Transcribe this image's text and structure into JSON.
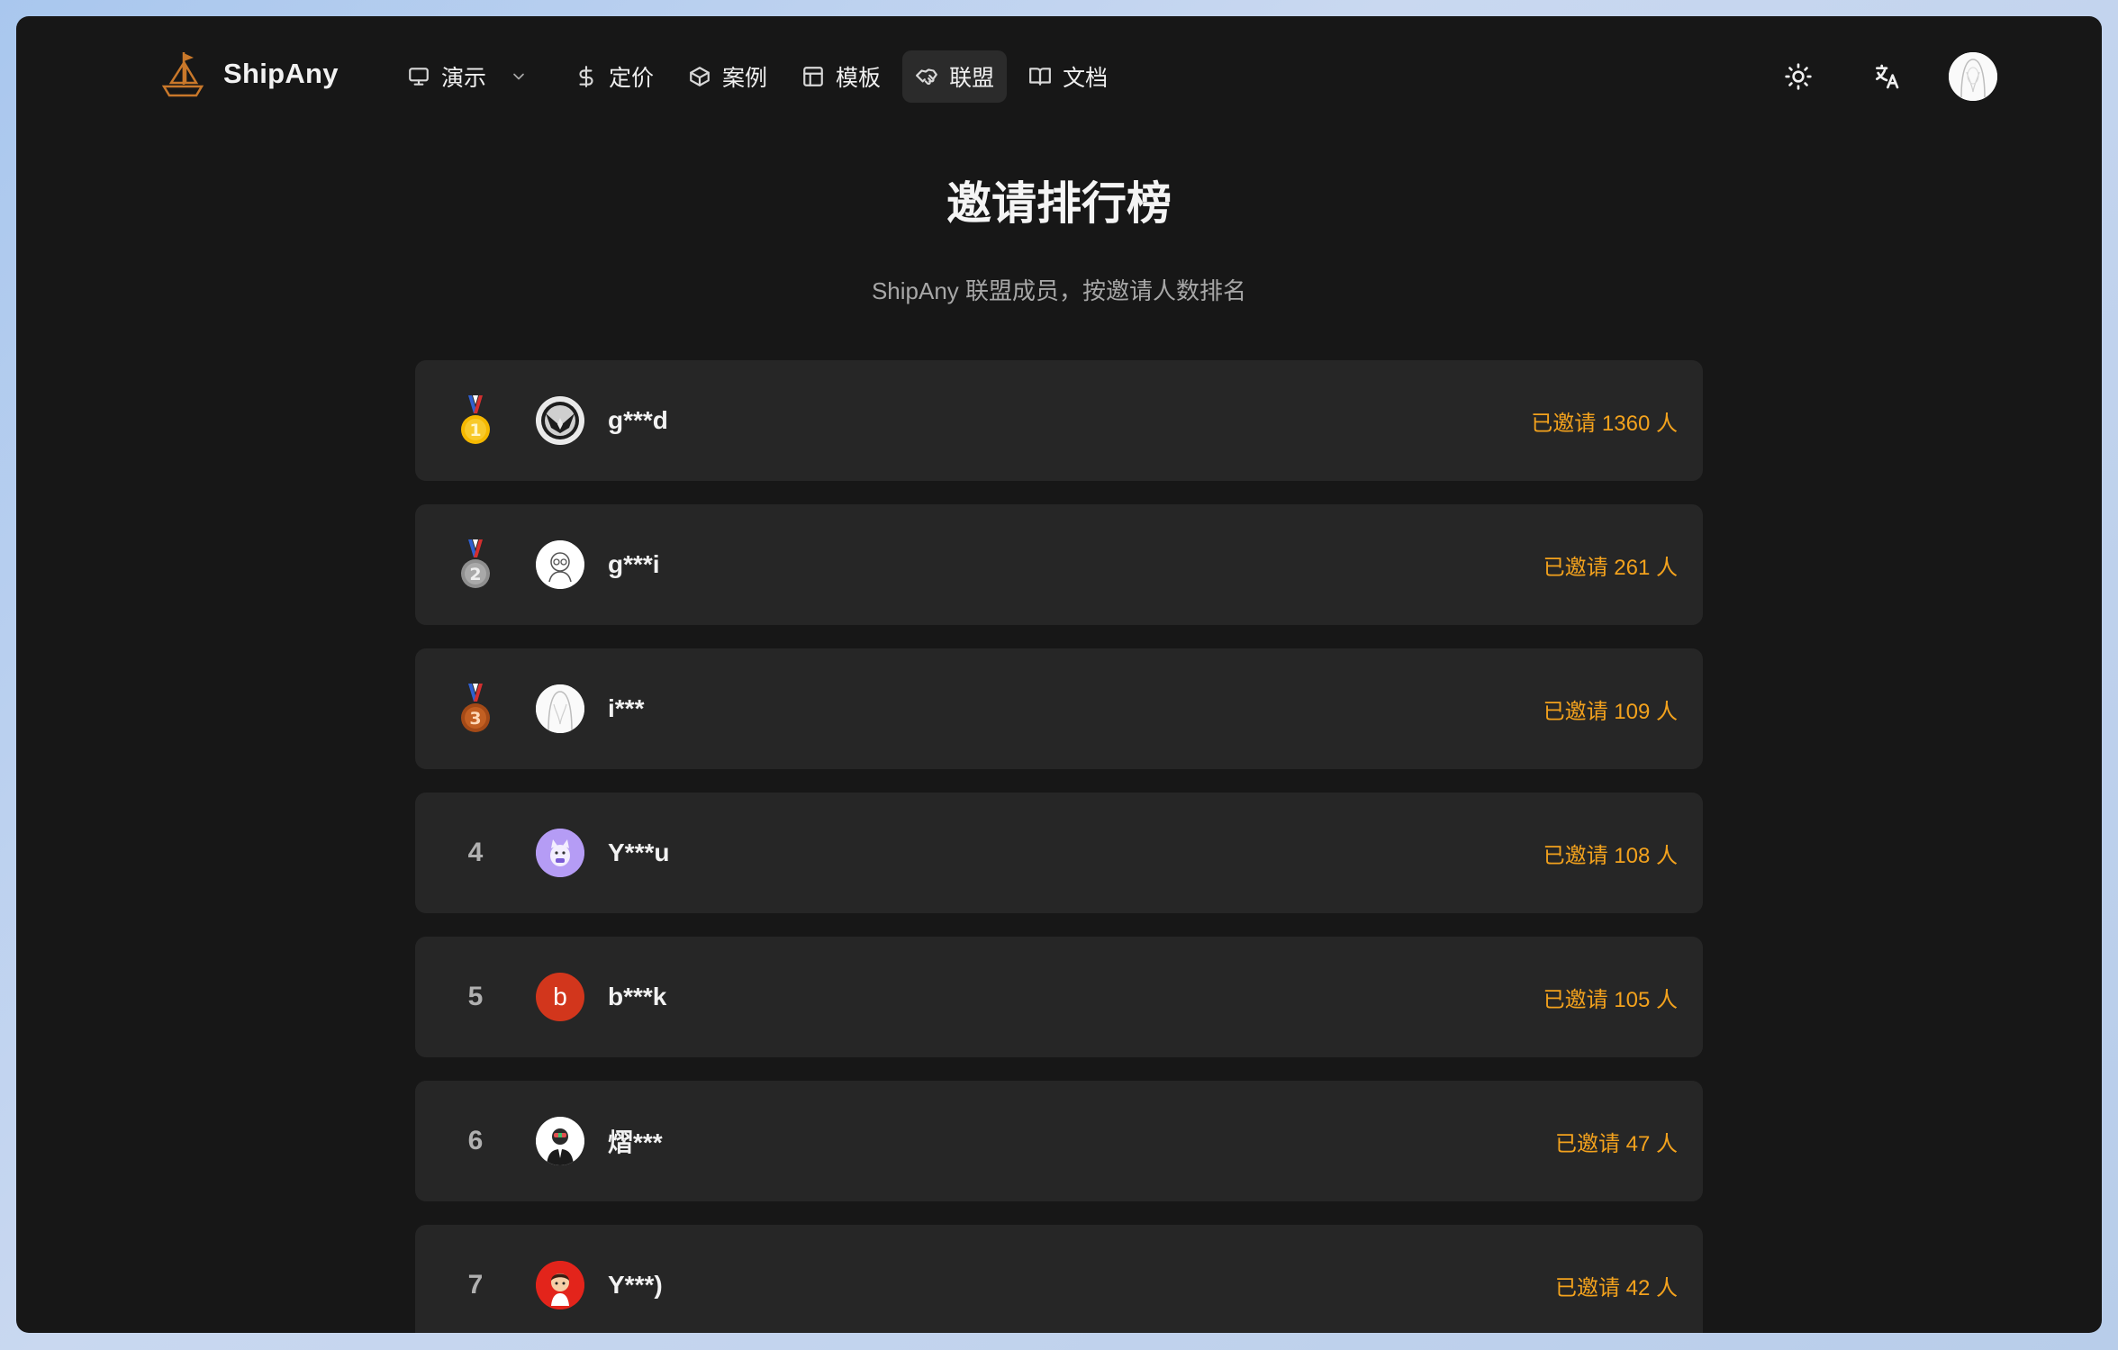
{
  "header": {
    "brand": "ShipAny",
    "nav": [
      {
        "label": "演示",
        "icon": "monitor-icon",
        "has_dropdown": true
      },
      {
        "label": "定价",
        "icon": "dollar-icon"
      },
      {
        "label": "案例",
        "icon": "box-icon"
      },
      {
        "label": "模板",
        "icon": "layout-icon"
      },
      {
        "label": "联盟",
        "icon": "handshake-icon",
        "active": true
      },
      {
        "label": "文档",
        "icon": "book-icon"
      }
    ],
    "tools": [
      "sun-icon",
      "translate-icon",
      "user-avatar"
    ]
  },
  "page": {
    "title": "邀请排行榜",
    "subtitle": "ShipAny 联盟成员，按邀请人数排名"
  },
  "leaderboard": [
    {
      "rank": "1",
      "medal": "gold",
      "name": "g***d",
      "count_text": "已邀请 1360 人"
    },
    {
      "rank": "2",
      "medal": "silver",
      "name": "g***i",
      "count_text": "已邀请 261 人"
    },
    {
      "rank": "3",
      "medal": "bronze",
      "name": "i***",
      "count_text": "已邀请 109 人"
    },
    {
      "rank": "4",
      "name": "Y***u",
      "count_text": "已邀请 108 人"
    },
    {
      "rank": "5",
      "name": "b***k",
      "avatar_letter": "b",
      "count_text": "已邀请 105 人"
    },
    {
      "rank": "6",
      "name": "熠***",
      "count_text": "已邀请 47 人"
    },
    {
      "rank": "7",
      "name": "Y***)",
      "count_text": "已邀请 42 人"
    }
  ],
  "colors": {
    "background": "#171717",
    "card": "#262626",
    "accent_count": "#f3a21d",
    "gold": "#f5b800",
    "silver": "#9e9e9e",
    "bronze": "#b5541c"
  }
}
